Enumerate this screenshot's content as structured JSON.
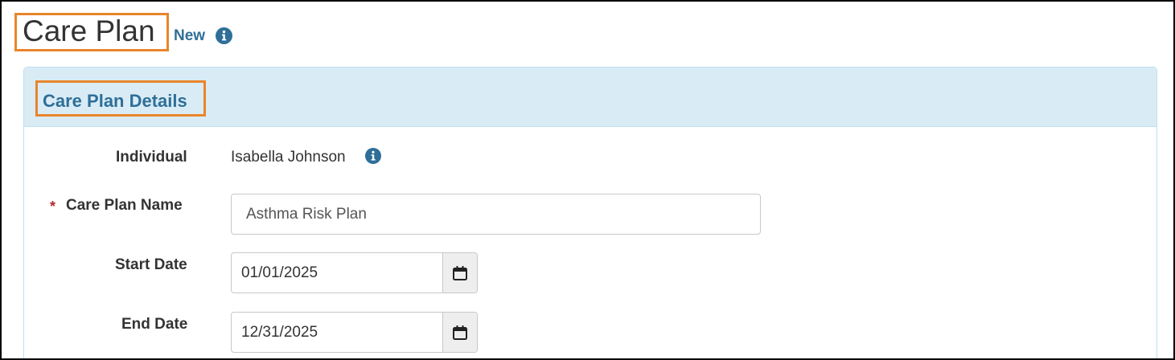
{
  "header": {
    "title": "Care Plan",
    "status": "New",
    "info_icon": "info-circle-icon"
  },
  "section": {
    "title": "Care Plan Details"
  },
  "form": {
    "individual": {
      "label": "Individual",
      "value": "Isabella Johnson",
      "info_icon": "info-circle-icon"
    },
    "care_plan_name": {
      "required_marker": "*",
      "label": "Care Plan Name",
      "value": "Asthma Risk Plan"
    },
    "start_date": {
      "label": "Start Date",
      "value": "01/01/2025",
      "icon": "calendar-icon"
    },
    "end_date": {
      "label": "End Date",
      "value": "12/31/2025",
      "icon": "calendar-icon"
    }
  },
  "colors": {
    "accent": "#2f6f97",
    "highlight_border": "#e8852a",
    "panel_header_bg": "#d9ecf6",
    "required": "#b42a2a"
  }
}
